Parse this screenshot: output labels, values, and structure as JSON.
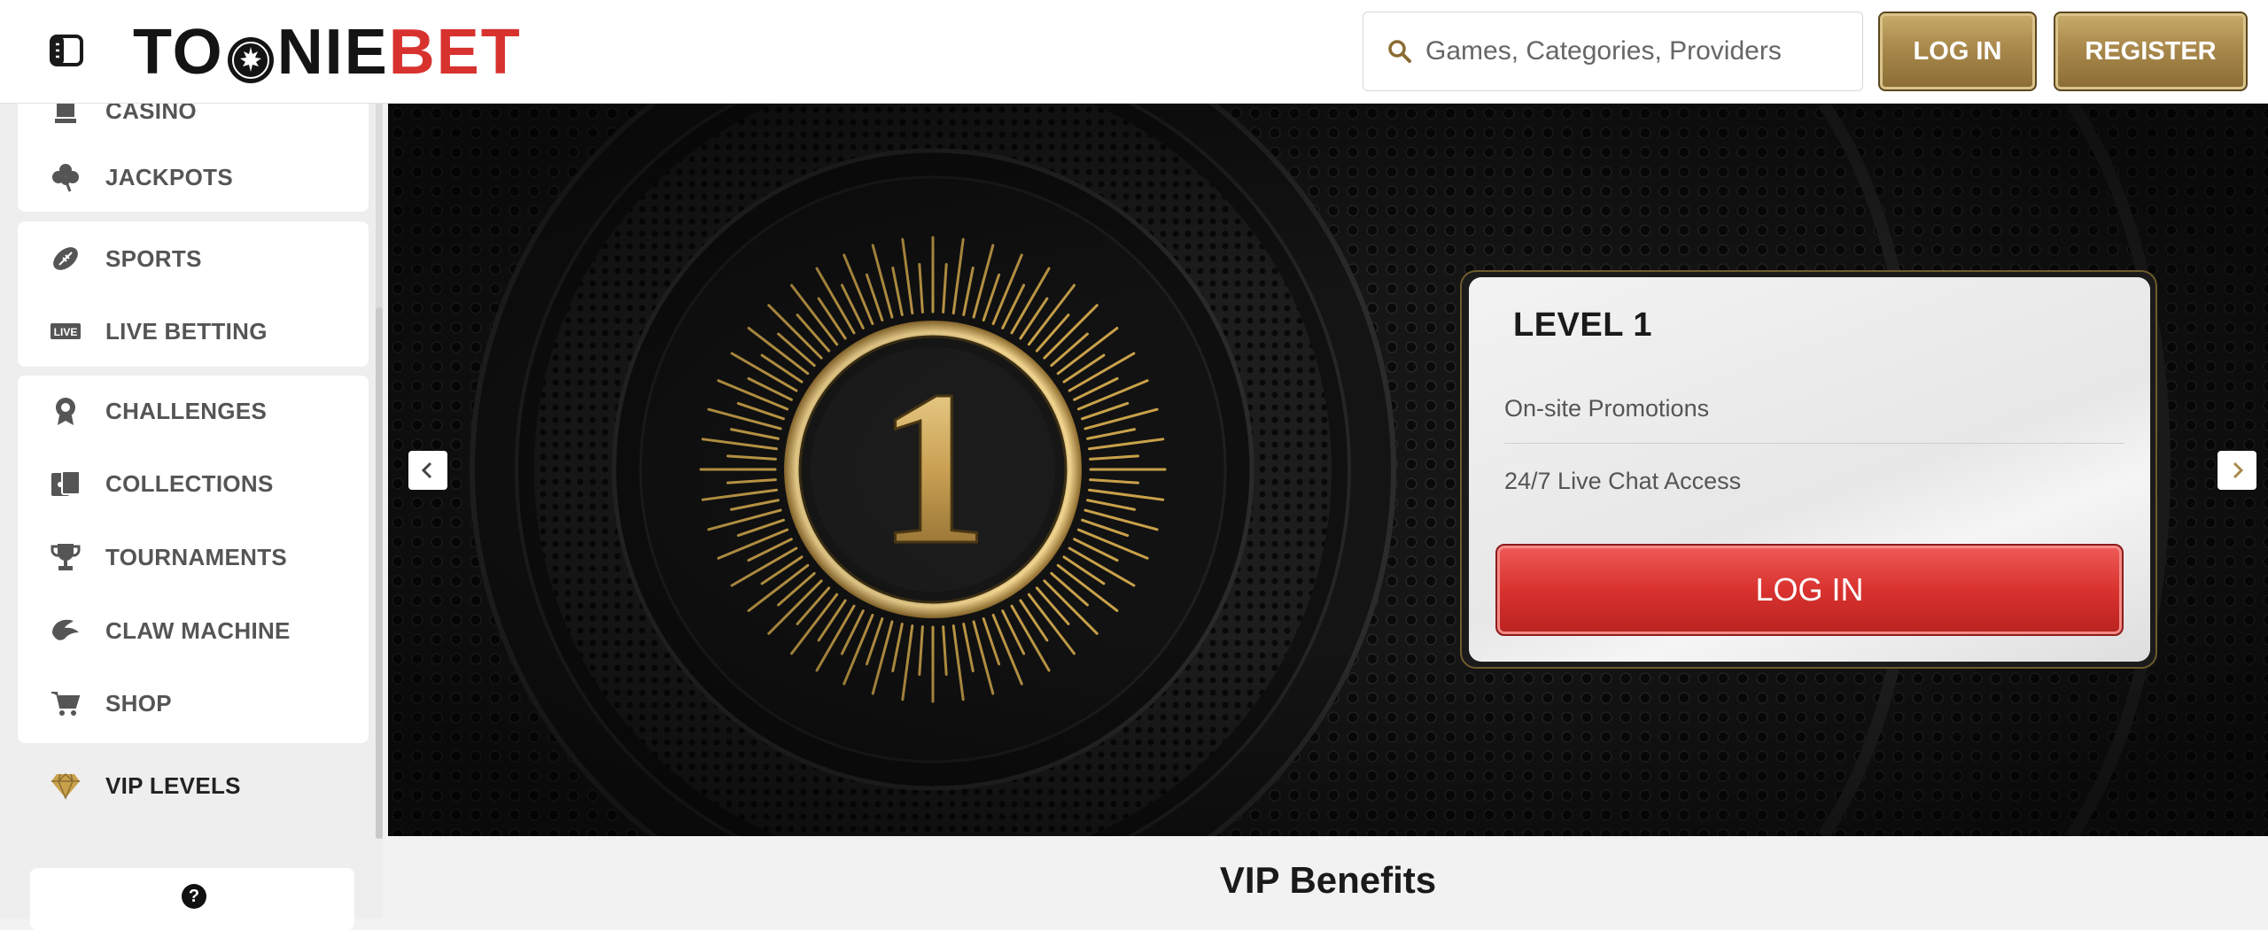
{
  "header": {
    "logo": {
      "part1": "TO",
      "part2": "NIE",
      "part3": "BET"
    },
    "search": {
      "placeholder": "Games, Categories, Providers"
    },
    "login_label": "LOG IN",
    "register_label": "REGISTER"
  },
  "sidebar": {
    "group1": [
      {
        "label": "CASINO",
        "icon": "casino-icon"
      },
      {
        "label": "JACKPOTS",
        "icon": "clover-icon"
      }
    ],
    "group2": [
      {
        "label": "SPORTS",
        "icon": "football-icon"
      },
      {
        "label": "LIVE BETTING",
        "icon": "live-icon",
        "badge": "LIVE"
      }
    ],
    "group3": [
      {
        "label": "CHALLENGES",
        "icon": "medal-icon"
      },
      {
        "label": "COLLECTIONS",
        "icon": "cards-icon"
      },
      {
        "label": "TOURNAMENTS",
        "icon": "trophy-icon"
      },
      {
        "label": "CLAW MACHINE",
        "icon": "claw-icon"
      },
      {
        "label": "SHOP",
        "icon": "cart-icon"
      }
    ],
    "vip": {
      "label": "VIP LEVELS",
      "icon": "diamond-icon"
    },
    "help_icon": "question-icon"
  },
  "banner": {
    "level_numeral": "1",
    "card": {
      "title": "LEVEL 1",
      "benefits": [
        "On-site Promotions",
        "24/7 Live Chat Access"
      ],
      "button_label": "LOG IN"
    },
    "colors": {
      "gold": "#c9a14a",
      "button_red": "#d9322f"
    }
  },
  "section_title": "VIP Benefits",
  "colors": {
    "brand_red": "#d8322f",
    "gold_button": "#a9894c"
  }
}
